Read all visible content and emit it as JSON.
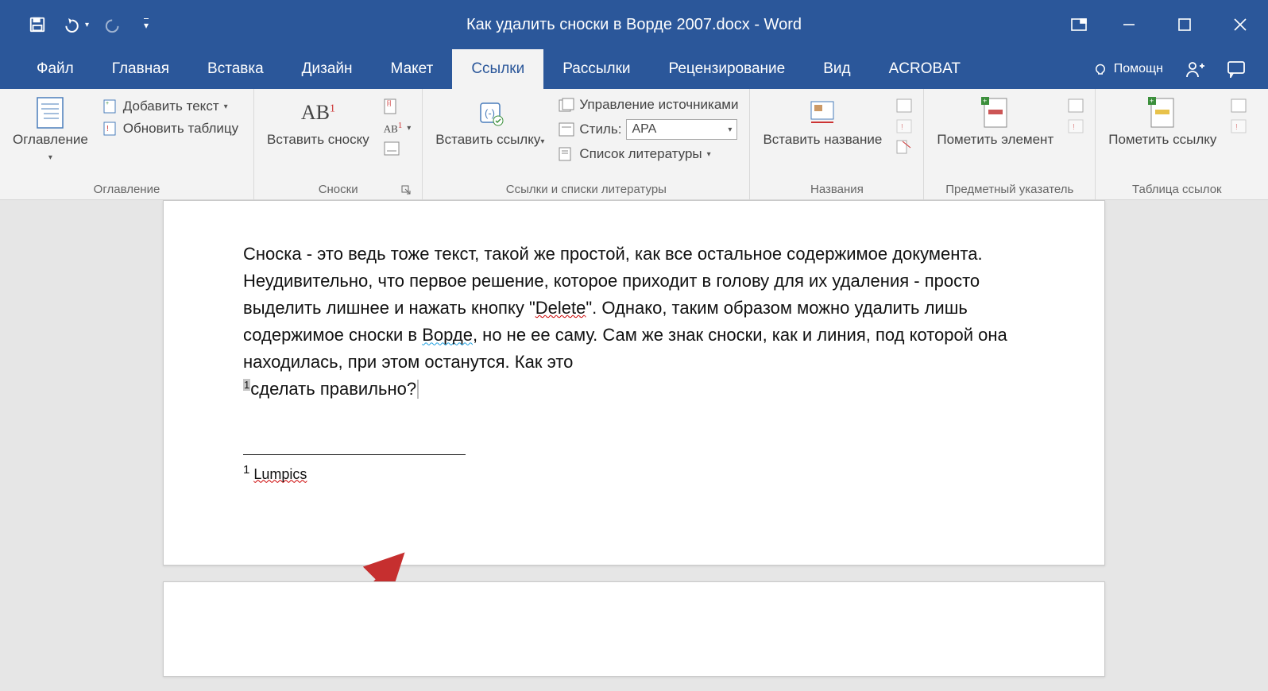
{
  "title": "Как удалить сноски в Ворде 2007.docx - Word",
  "qat": {
    "save": "Save",
    "undo": "Undo",
    "redo": "Redo",
    "custom": "Customize"
  },
  "win": {
    "ribbon_opts": "Ribbon Display Options",
    "minimize": "Minimize",
    "maximize": "Restore",
    "close": "Close"
  },
  "tabs": {
    "file": "Файл",
    "home": "Главная",
    "insert": "Вставка",
    "design": "Дизайн",
    "layout": "Макет",
    "references": "Ссылки",
    "mailings": "Рассылки",
    "review": "Рецензирование",
    "view": "Вид",
    "acrobat": "ACROBAT",
    "tell_me": "Помощн",
    "share": "Share",
    "comments": "Comments"
  },
  "ribbon": {
    "toc": {
      "big": "Оглавление",
      "add_text": "Добавить текст",
      "update": "Обновить таблицу",
      "group": "Оглавление"
    },
    "footnotes": {
      "insert": "Вставить сноску",
      "insert_end": "Insert Endnote",
      "next": "Next Footnote",
      "show": "Show Notes",
      "group": "Сноски"
    },
    "citations": {
      "insert": "Вставить ссылку",
      "manage": "Управление источниками",
      "style_lbl": "Стиль:",
      "style_val": "APA",
      "biblio": "Список литературы",
      "group": "Ссылки и списки литературы"
    },
    "captions": {
      "insert": "Вставить название",
      "tof": "Insert Table of Figures",
      "update": "Update Table",
      "xref": "Cross-reference",
      "group": "Названия"
    },
    "index": {
      "mark": "Пометить элемент",
      "insert": "Insert Index",
      "update": "Update Index",
      "group": "Предметный указатель"
    },
    "toa": {
      "mark": "Пометить ссылку",
      "insert": "Insert Table of Authorities",
      "update": "Update Table",
      "group": "Таблица ссылок"
    }
  },
  "document": {
    "para": "Сноска - это ведь тоже текст, такой же простой, как все остальное содержимое документа. Неудивительно, что первое решение, которое приходит в голову для их удаления - просто выделить лишнее и нажать кнопку \"",
    "word_delete": "Delete",
    "para2": "\". Однако, таким образом можно удалить лишь содержимое сноски в ",
    "word_vorde": "Ворде",
    "para3": ", но не ее саму. Сам же знак сноски, как и линия, под которой она находилась, при этом останутся. Как это ",
    "ref_num": "1",
    "para4": "сделать правильно?",
    "fn_num": "1",
    "fn_text": "Lumpics"
  }
}
